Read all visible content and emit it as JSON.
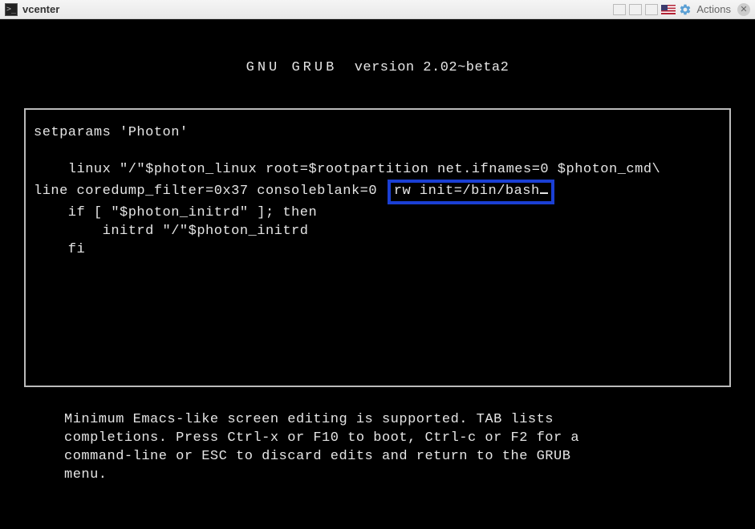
{
  "titlebar": {
    "title": "vcenter",
    "actions_label": "Actions"
  },
  "grub": {
    "header_app": "GNU GRUB",
    "header_version": "version 2.02~beta2",
    "content": {
      "line1": "setparams 'Photon'",
      "line2_prefix": "    linux \"/\"$photon_linux root=$rootpartition net.ifnames=0 $photon_cmd\\",
      "line3_prefix": "line coredump_filter=0x37 consoleblank=0",
      "line3_highlight": "rw init=/bin/bash",
      "line4": "    if [ \"$photon_initrd\" ]; then",
      "line5": "        initrd \"/\"$photon_initrd",
      "line6": "    fi"
    },
    "footer": "Minimum Emacs-like screen editing is supported. TAB lists\ncompletions. Press Ctrl-x or F10 to boot, Ctrl-c or F2 for a\ncommand-line or ESC to discard edits and return to the GRUB\nmenu."
  }
}
